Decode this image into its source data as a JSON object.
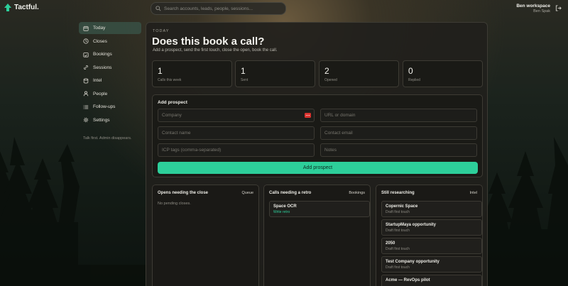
{
  "app": {
    "name": "Tactful."
  },
  "search": {
    "placeholder": "Search accounts, leads, people, sessions..."
  },
  "workspace": {
    "name": "Ben workspace",
    "user": "Ben Spak"
  },
  "sidebar": {
    "items": [
      {
        "label": "Today",
        "icon": "calendar-icon",
        "active": true
      },
      {
        "label": "Closes",
        "icon": "clock-icon"
      },
      {
        "label": "Bookings",
        "icon": "calendar-check-icon"
      },
      {
        "label": "Sessions",
        "icon": "link-icon"
      },
      {
        "label": "Intel",
        "icon": "database-icon"
      },
      {
        "label": "People",
        "icon": "person-icon"
      },
      {
        "label": "Follow-ups",
        "icon": "list-icon"
      },
      {
        "label": "Settings",
        "icon": "gear-icon"
      }
    ],
    "tagline": "Talk first. Admin disappears."
  },
  "page": {
    "eyebrow": "TODAY",
    "title": "Does this book a call?",
    "subtitle": "Add a prospect, send the first touch, close the open, book the call."
  },
  "stats": [
    {
      "value": "1",
      "label": "Calls this week"
    },
    {
      "value": "1",
      "label": "Sent"
    },
    {
      "value": "2",
      "label": "Opened"
    },
    {
      "value": "0",
      "label": "Replied"
    }
  ],
  "add_prospect": {
    "title": "Add prospect",
    "fields": {
      "company": "Company",
      "url": "URL or domain",
      "contact_name": "Contact name",
      "contact_email": "Contact email",
      "icp_tags": "ICP tags (comma-separated)",
      "notes": "Notes"
    },
    "button": "Add prospect"
  },
  "panels": {
    "opens": {
      "title": "Opens needing the close",
      "link": "Queue",
      "empty": "No pending closes."
    },
    "retro": {
      "title": "Calls needing a retro",
      "link": "Bookings",
      "items": [
        {
          "title": "Space OCR",
          "sub": "Write retro"
        }
      ]
    },
    "research": {
      "title": "Still researching",
      "link": "Intel",
      "items": [
        {
          "title": "Copernic Space",
          "sub": "Draft first touch"
        },
        {
          "title": "StartupMaya opportunity",
          "sub": "Draft first touch"
        },
        {
          "title": "2050",
          "sub": "Draft first touch"
        },
        {
          "title": "Test Company opportunity",
          "sub": "Draft first touch"
        },
        {
          "title": "Acme — RevOps pilot",
          "sub": ""
        }
      ]
    }
  },
  "colors": {
    "accent": "#2dcf9a",
    "badge": "#d9332f"
  }
}
